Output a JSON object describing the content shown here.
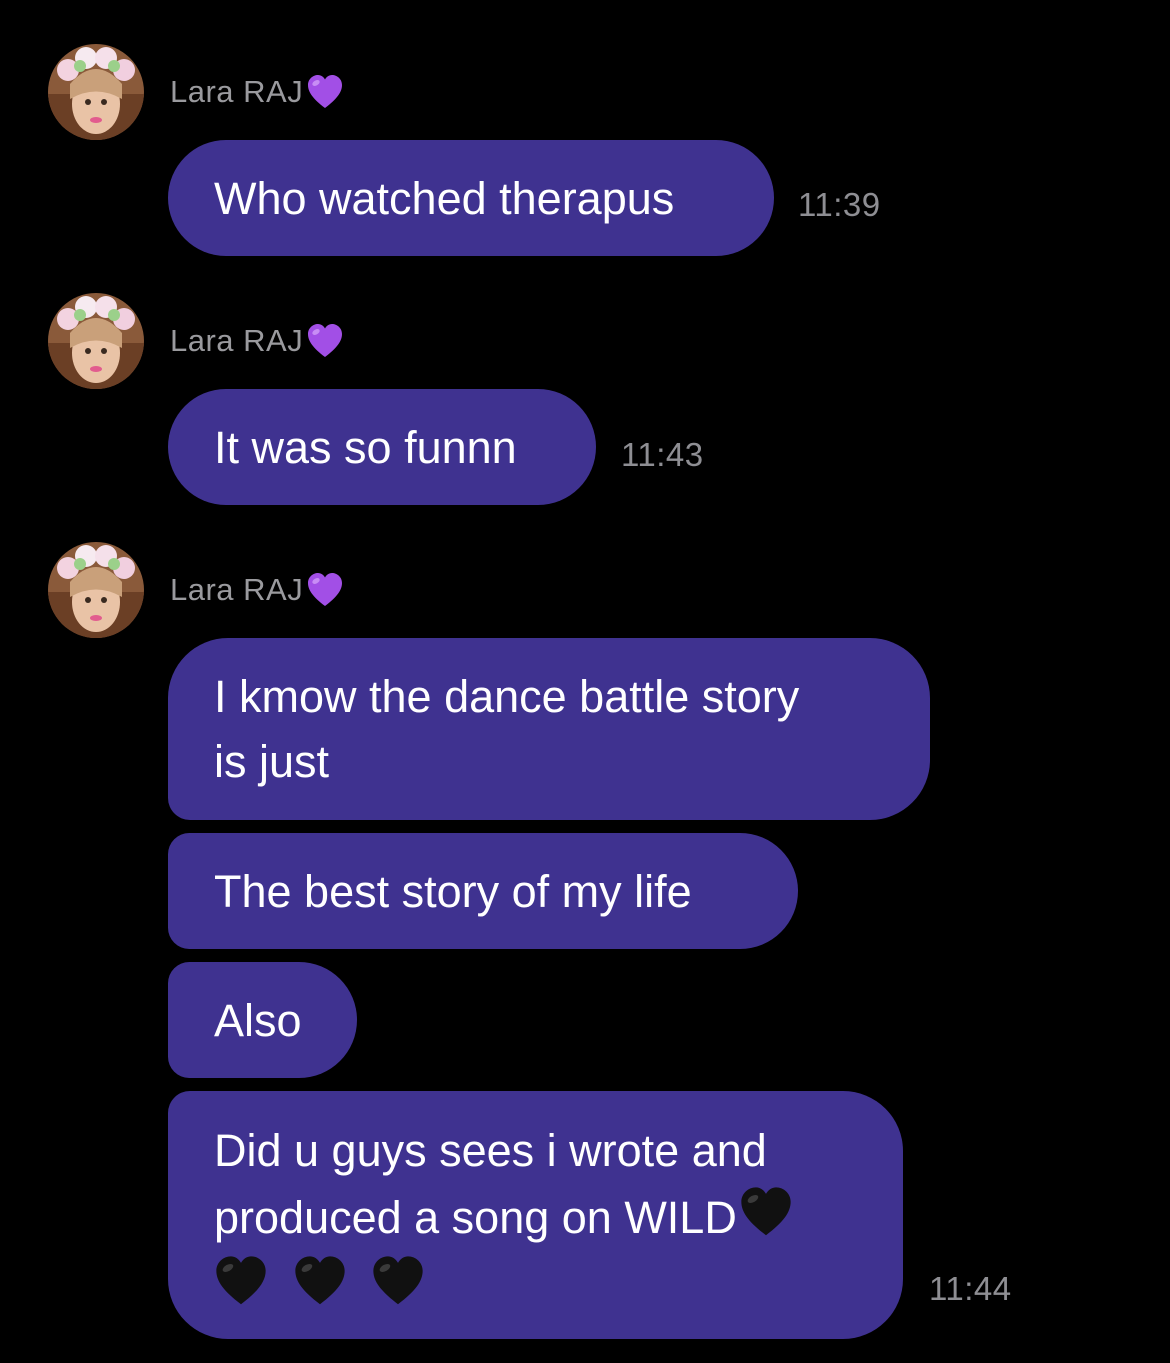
{
  "colors": {
    "background": "#000000",
    "bubble": "#3f3290",
    "sender_name": "#9a9a9e",
    "timestamp": "#8e8e93",
    "purple_heart": "#a24fe6",
    "black_heart": "#111111"
  },
  "groups": [
    {
      "sender": "Lara RAJ",
      "sender_emoji": "purple-heart",
      "messages": [
        {
          "text": "Who watched therapus",
          "time": "11:39"
        }
      ]
    },
    {
      "sender": "Lara RAJ",
      "sender_emoji": "purple-heart",
      "messages": [
        {
          "text": "It was so funnn",
          "time": "11:43"
        }
      ]
    },
    {
      "sender": "Lara RAJ",
      "sender_emoji": "purple-heart",
      "messages": [
        {
          "line1": "I kmow the dance battle story",
          "line2": "is just"
        },
        {
          "text": "The best story of my life"
        },
        {
          "text": "Also"
        },
        {
          "line1": "Did u guys sees i wrote and",
          "line2": "produced a song on WILD",
          "emoji": "black-heart",
          "time": "11:44"
        }
      ]
    }
  ]
}
